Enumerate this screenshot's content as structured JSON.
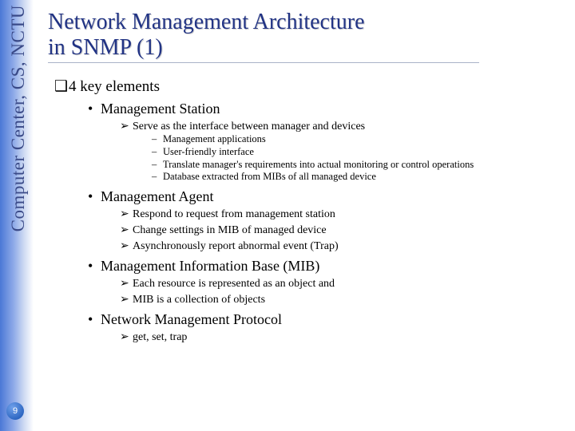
{
  "sidebar": {
    "label": "Computer Center, CS, NCTU"
  },
  "page_number": "9",
  "title": {
    "line1": "Network Management Architecture",
    "line2": "in SNMP (1)"
  },
  "lvl1": {
    "heading": "4 key elements"
  },
  "items": [
    {
      "label": "Management Station",
      "arrows": [
        {
          "text": "Serve as the interface between manager and devices",
          "dashes": [
            "Management applications",
            "User-friendly interface",
            "Translate manager's requirements into actual monitoring or control operations",
            "Database extracted from MIBs of all managed device"
          ]
        }
      ]
    },
    {
      "label": "Management Agent",
      "arrows": [
        {
          "text": "Respond to request from management station"
        },
        {
          "text": "Change settings in MIB of managed device"
        },
        {
          "text": "Asynchronously report abnormal event (Trap)"
        }
      ]
    },
    {
      "label": "Management Information Base (MIB)",
      "arrows": [
        {
          "text": "Each resource is represented as an object and"
        },
        {
          "text": "MIB is a collection of objects"
        }
      ]
    },
    {
      "label": "Network Management Protocol",
      "arrows": [
        {
          "text": "get, set, trap"
        }
      ]
    }
  ],
  "marks": {
    "square": "❑",
    "bullet": "•",
    "arrow": "➢",
    "dash": "–"
  }
}
